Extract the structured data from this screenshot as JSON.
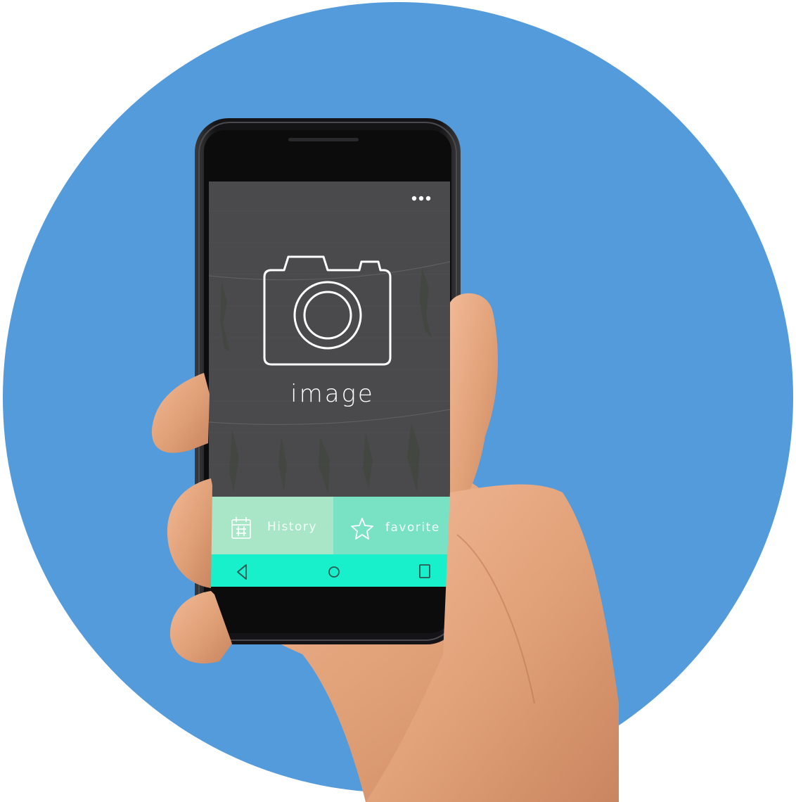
{
  "app": {
    "title": "image",
    "menu_icon": "more-dots-icon",
    "hero_icon": "camera-icon"
  },
  "tabs": [
    {
      "label": "History",
      "icon": "calendar-icon",
      "color": "#a8e6c7"
    },
    {
      "label": "favorite",
      "icon": "star-icon",
      "color": "#79e2c5"
    }
  ],
  "navbar": {
    "color": "#18f0cc",
    "buttons": [
      "back-icon",
      "home-icon",
      "recents-icon"
    ]
  },
  "colors": {
    "background_circle": "#539bdb",
    "screen_overlay": "#4a4a4c",
    "phone_body": "#1b1b1d",
    "skin": "#e2a37a"
  }
}
